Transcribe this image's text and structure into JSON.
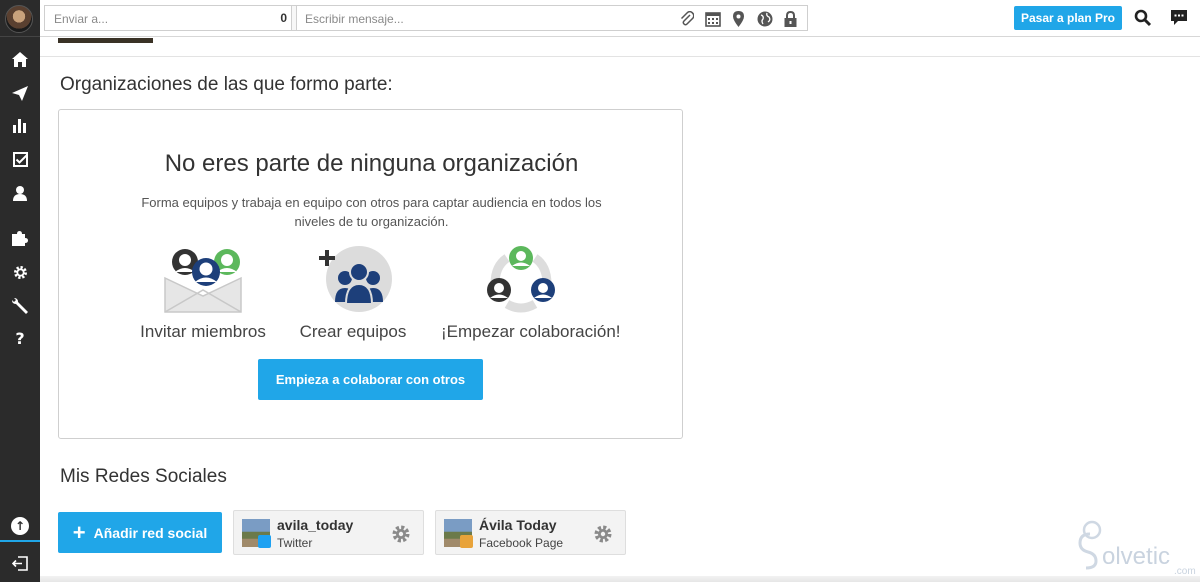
{
  "topbar": {
    "send_placeholder": "Enviar a...",
    "recipient_count": "0",
    "message_placeholder": "Escribir mensaje...",
    "pro_button": "Pasar a plan Pro"
  },
  "sidebar": {
    "items": [
      {
        "icon": "home-icon"
      },
      {
        "icon": "send-icon"
      },
      {
        "icon": "analytics-icon"
      },
      {
        "icon": "tasks-icon"
      },
      {
        "icon": "contacts-icon"
      },
      {
        "icon": "apps-icon"
      },
      {
        "icon": "settings-icon"
      },
      {
        "icon": "tools-icon"
      },
      {
        "icon": "help-icon"
      }
    ]
  },
  "organizations": {
    "heading": "Organizaciones de las que formo parte:",
    "empty_title": "No eres parte de ninguna organización",
    "empty_desc": "Forma equipos y trabaja en equipo con otros para captar audiencia en todos los niveles de tu organización.",
    "features": [
      {
        "label": "Invitar miembros",
        "icon": "invite-members-icon"
      },
      {
        "label": "Crear equipos",
        "icon": "create-teams-icon"
      },
      {
        "label": "¡Empezar colaboración!",
        "icon": "collaboration-icon"
      }
    ],
    "cta": "Empieza a colaborar con otros"
  },
  "social": {
    "heading": "Mis Redes Sociales",
    "add_button": "Añadir red social",
    "networks": [
      {
        "name": "avila_today",
        "type": "Twitter",
        "badge_color": "#1da1f2"
      },
      {
        "name": "Ávila Today",
        "type": "Facebook Page",
        "badge_color": "#e8a33a"
      }
    ]
  },
  "colors": {
    "accent": "#20a6e8",
    "sidebar": "#2b2b2b"
  }
}
